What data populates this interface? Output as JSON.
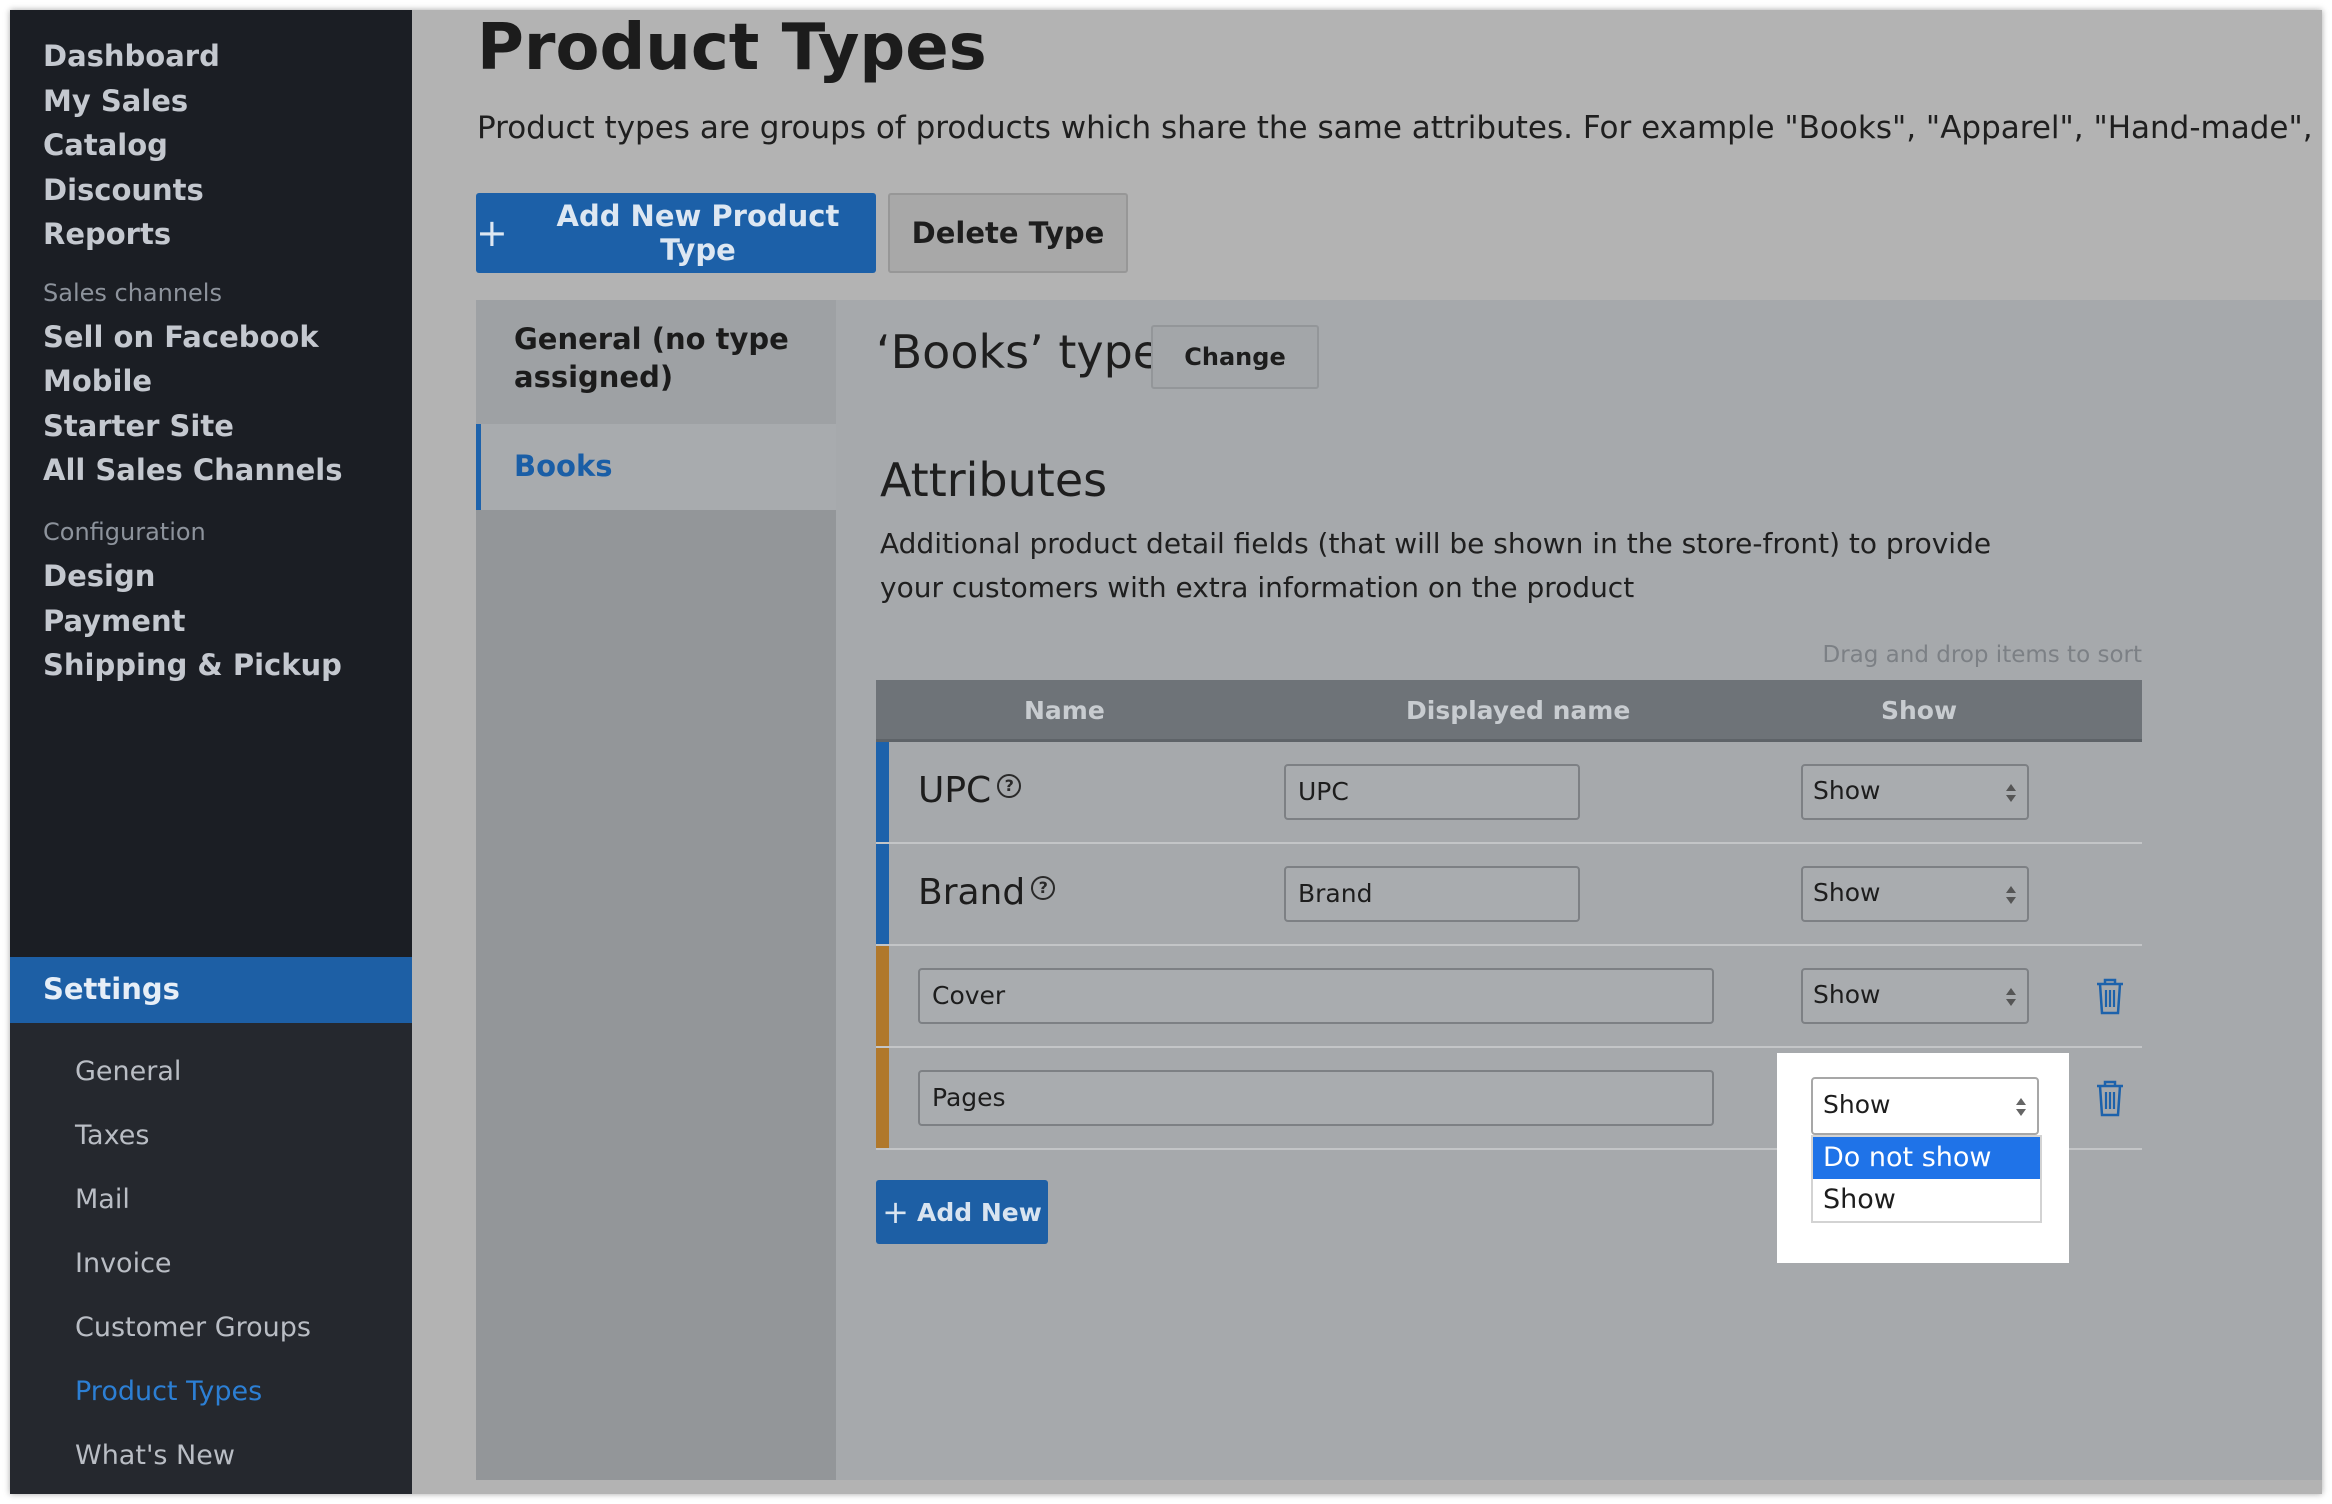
{
  "sidebar": {
    "main_items": [
      "Dashboard",
      "My Sales",
      "Catalog",
      "Discounts",
      "Reports"
    ],
    "sales_channels_header": "Sales channels",
    "sales_channels": [
      "Sell on Facebook",
      "Mobile",
      "Starter Site",
      "All Sales Channels"
    ],
    "configuration_header": "Configuration",
    "configuration": [
      "Design",
      "Payment",
      "Shipping & Pickup"
    ],
    "active_item": "Settings",
    "settings_sub": [
      "General",
      "Taxes",
      "Mail",
      "Invoice",
      "Customer Groups",
      "Product Types",
      "What's New"
    ],
    "current_sub": "Product Types"
  },
  "page": {
    "title": "Product Types",
    "description": "Product types are groups of products which share the same attributes. For example \"Books\", \"Apparel\", \"Hand-made\", etc.",
    "add_button": "Add New Product Type",
    "delete_button": "Delete Type"
  },
  "types": {
    "general": "General (no type assigned)",
    "books": "Books"
  },
  "detail": {
    "title": "‘Books’ type",
    "change_button": "Change",
    "attributes_title": "Attributes",
    "attributes_desc": "Additional product detail fields (that will be shown in the store-front) to provide your customers with extra information on the product",
    "drag_hint": "Drag and drop items to sort",
    "columns": {
      "name": "Name",
      "displayed": "Displayed name",
      "show": "Show"
    },
    "rows": [
      {
        "name": "UPC",
        "displayed": "UPC",
        "show": "Show",
        "kind": "system"
      },
      {
        "name": "Brand",
        "displayed": "Brand",
        "show": "Show",
        "kind": "system"
      },
      {
        "name": "Cover",
        "show": "Show",
        "kind": "custom"
      },
      {
        "name": "Pages",
        "show": "Show",
        "kind": "custom"
      }
    ],
    "add_new": "Add New",
    "dropdown": {
      "selected": "Show",
      "options": [
        "Do not show",
        "Show"
      ],
      "highlighted": "Do not show"
    }
  },
  "colors": {
    "sidebar_bg": "#1b1e24",
    "accent_blue": "#1d5fa5",
    "system_row_accent": "#1d62ab",
    "custom_row_accent": "#b0782b",
    "trash_icon": "#1d62ab"
  },
  "icons": {
    "plus": "plus-icon",
    "help": "help-circle-icon",
    "trash": "trash-icon",
    "select_arrows": "updown-arrows-icon"
  }
}
